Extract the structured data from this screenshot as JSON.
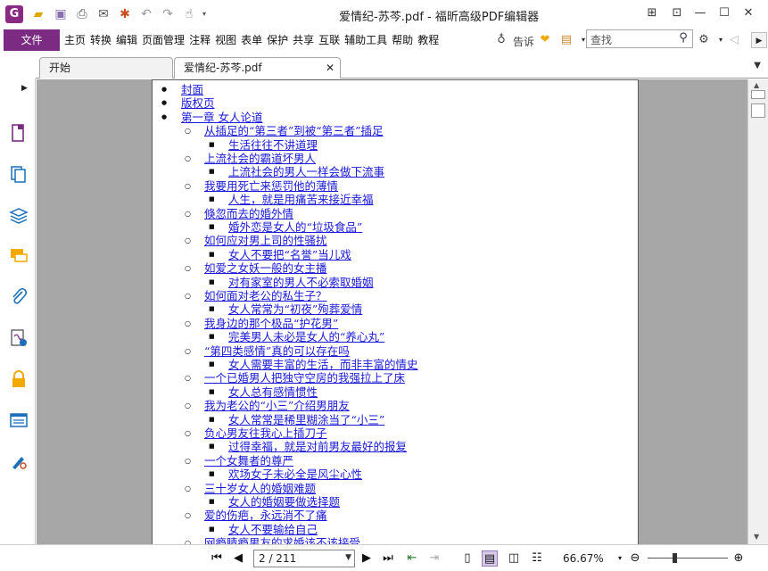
{
  "window": {
    "title": "爱情纪-苏芩.pdf - 福昕高级PDF编辑器",
    "app_logo": "G"
  },
  "menu": {
    "file_label": "文件",
    "items": [
      "主页",
      "转换",
      "编辑",
      "页面管理",
      "注释",
      "视图",
      "表单",
      "保护",
      "共享",
      "互联",
      "辅助工具",
      "帮助",
      "教程"
    ],
    "tell_me": "告诉",
    "search_placeholder": "查找"
  },
  "tabs": [
    {
      "label": "开始",
      "active": false
    },
    {
      "label": "爱情纪-苏芩.pdf",
      "active": true
    }
  ],
  "sidebar_icons": [
    "pages-icon",
    "copy-pages-icon",
    "layers-icon",
    "comments-icon",
    "attachments-icon",
    "signature-icon",
    "security-lock-icon",
    "form-fields-icon",
    "certificate-icon"
  ],
  "toc": [
    {
      "level": 1,
      "text": "封面"
    },
    {
      "level": 1,
      "text": "版权页"
    },
    {
      "level": 1,
      "text": "第一章 女人论道"
    },
    {
      "level": 2,
      "text": "从插足的“第三者”到被“第三者”插足"
    },
    {
      "level": 3,
      "text": "生活往往不讲道理"
    },
    {
      "level": 2,
      "text": "上流社会的霸道坏男人"
    },
    {
      "level": 3,
      "text": "上流社会的男人一样会做下流事"
    },
    {
      "level": 2,
      "text": "我要用死亡来惩罚他的薄情"
    },
    {
      "level": 3,
      "text": "人生，就是用痛苦来接近幸福"
    },
    {
      "level": 2,
      "text": "倏忽而去的婚外情"
    },
    {
      "level": 3,
      "text": "婚外恋是女人的“垃圾食品”"
    },
    {
      "level": 2,
      "text": "如何应对男上司的性骚扰"
    },
    {
      "level": 3,
      "text": "女人不要把“名誉”当儿戏"
    },
    {
      "level": 2,
      "text": "如爱之女妖一般的女主播"
    },
    {
      "level": 3,
      "text": "对有家室的男人不必索取婚姻"
    },
    {
      "level": 2,
      "text": "如何面对老公的私生子？"
    },
    {
      "level": 3,
      "text": "女人常常为“初夜”殉葬爱情"
    },
    {
      "level": 2,
      "text": "我身边的那个极品“护花男”"
    },
    {
      "level": 3,
      "text": "完美男人未必是女人的“养心丸”"
    },
    {
      "level": 2,
      "text": "“第四类感情”真的可以存在吗"
    },
    {
      "level": 3,
      "text": "女人需要丰富的生活，而非丰富的情史"
    },
    {
      "level": 2,
      "text": "一个已婚男人把独守空房的我强拉上了床"
    },
    {
      "level": 3,
      "text": "女人总有感情惯性"
    },
    {
      "level": 2,
      "text": "我为老公的“小三”介绍男朋友"
    },
    {
      "level": 3,
      "text": "女人常常是稀里糊涂当了“小三”"
    },
    {
      "level": 2,
      "text": "负心男友往我心上插刀子"
    },
    {
      "level": 3,
      "text": "过得幸福，就是对前男友最好的报复"
    },
    {
      "level": 2,
      "text": "一个女舞者的尊严"
    },
    {
      "level": 3,
      "text": "欢场女子未必全是风尘心性"
    },
    {
      "level": 2,
      "text": "三十岁女人的婚姻难题"
    },
    {
      "level": 3,
      "text": "女人的婚姻要做选择题"
    },
    {
      "level": 2,
      "text": "爱的伤疤，永远消不了痛"
    },
    {
      "level": 3,
      "text": "女人不要输给自己"
    },
    {
      "level": 2,
      "text": "网瘾睛瘾男友的求婚该不该接受"
    }
  ],
  "status": {
    "page_indicator": "2 / 211",
    "zoom": "66.67%"
  }
}
